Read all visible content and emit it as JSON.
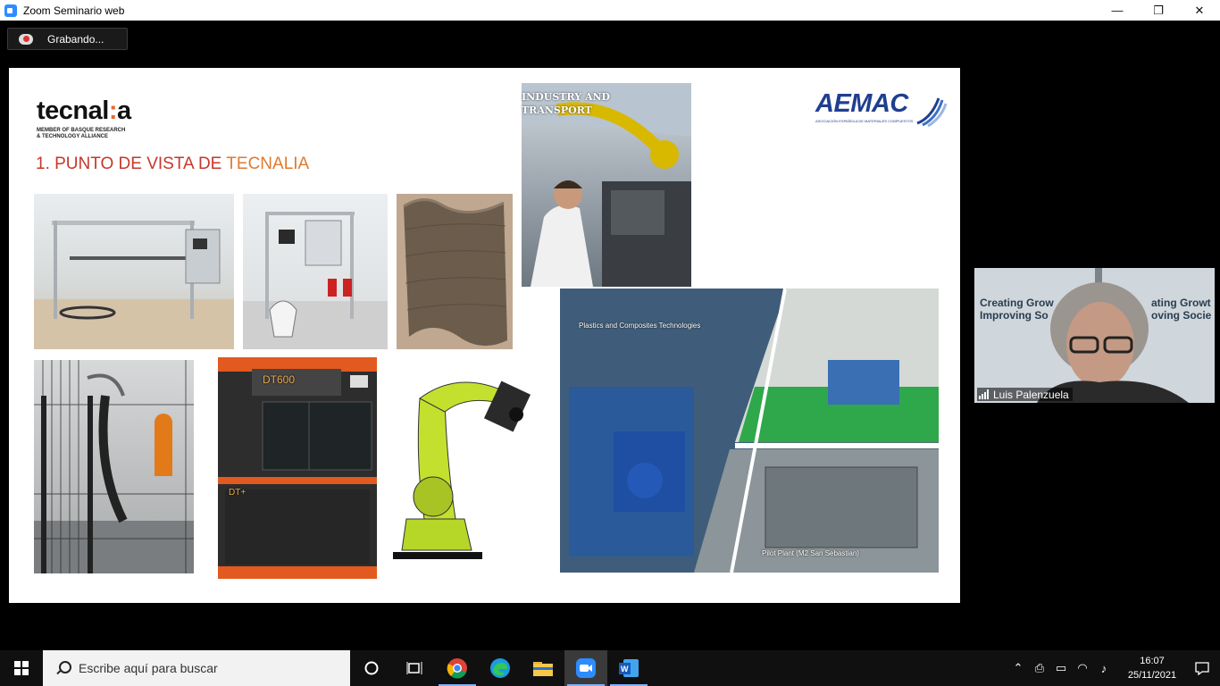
{
  "window": {
    "title": "Zoom Seminario web",
    "controls": [
      "—",
      "❐",
      "✕"
    ]
  },
  "recording": {
    "label": "Grabando..."
  },
  "slide": {
    "logo_text_left": "tecnal",
    "logo_text_sep": ":",
    "logo_text_right": "a",
    "logo_subtitle": "MEMBER OF BASQUE RESEARCH\n& TECHNOLOGY ALLIANCE",
    "title_prefix": "1. PUNTO DE VISTA DE ",
    "title_accent": "TECNALIA",
    "aemac_logo": "AEMAC",
    "aemac_sub": "ASOCIACIÓN ESPAÑOLA DE MATERIALES COMPUESTOS",
    "industry_label_1": "INDUSTRY AND",
    "industry_label_2": "TRANSPORT",
    "plastics_label": "Plastics and Composites Technologies",
    "pilot_label": "Pilot Plant (M2 San Sebastian)",
    "printer_badge_top": "DT600",
    "printer_badge_bottom": "DT+"
  },
  "participant": {
    "name": "Luis Palenzuela",
    "background_text_left_1": "Creating Grow",
    "background_text_left_2": "Improving So",
    "background_text_right_1": "ating Growt",
    "background_text_right_2": "oving Socie"
  },
  "taskbar": {
    "search_placeholder": "Escribe aquí para buscar",
    "time": "16:07",
    "date": "25/11/2021",
    "icons": [
      "windows-start-icon",
      "cortana-icon",
      "task-view-icon",
      "chrome-icon",
      "edge-icon",
      "file-explorer-icon",
      "zoom-icon",
      "word-icon"
    ]
  }
}
